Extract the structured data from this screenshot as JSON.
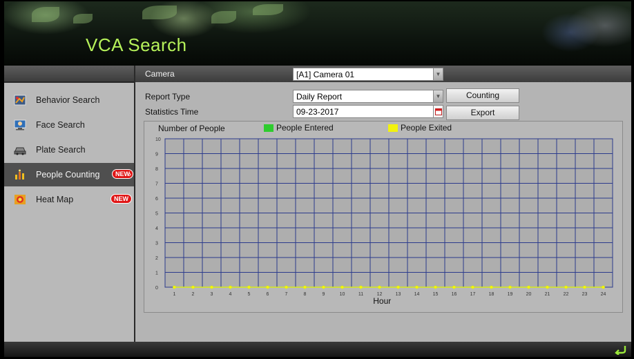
{
  "header": {
    "title": "VCA Search"
  },
  "sidebar": {
    "items": [
      {
        "label": "Behavior Search",
        "icon": "behavior-search-icon"
      },
      {
        "label": "Face Search",
        "icon": "face-search-icon"
      },
      {
        "label": "Plate Search",
        "icon": "plate-search-icon"
      },
      {
        "label": "People Counting",
        "icon": "people-counting-icon",
        "badge": "NEW",
        "active": true
      },
      {
        "label": "Heat Map",
        "icon": "heat-map-icon",
        "badge": "NEW"
      }
    ]
  },
  "form": {
    "camera_label": "Camera",
    "camera_value": "[A1] Camera 01",
    "report_type_label": "Report Type",
    "report_type_value": "Daily Report",
    "statistics_time_label": "Statistics Time",
    "statistics_time_value": "09-23-2017",
    "counting_button": "Counting",
    "export_button": "Export"
  },
  "colors": {
    "entered": "#2ecc2e",
    "exited": "#f2f20e",
    "grid": "#2b3a8c",
    "title_accent": "#b6f25a"
  },
  "chart_data": {
    "type": "line",
    "ylabel": "Number of People",
    "xlabel": "Hour",
    "x": [
      1,
      2,
      3,
      4,
      5,
      6,
      7,
      8,
      9,
      10,
      11,
      12,
      13,
      14,
      15,
      16,
      17,
      18,
      19,
      20,
      21,
      22,
      23,
      24
    ],
    "ylim": [
      0,
      10
    ],
    "yticks": [
      0,
      1,
      2,
      3,
      4,
      5,
      6,
      7,
      8,
      9,
      10
    ],
    "grid": true,
    "legend_position": "top",
    "series": [
      {
        "name": "People Entered",
        "color": "#2ecc2e",
        "values": [
          0,
          0,
          0,
          0,
          0,
          0,
          0,
          0,
          0,
          0,
          0,
          0,
          0,
          0,
          0,
          0,
          0,
          0,
          0,
          0,
          0,
          0,
          0,
          0
        ]
      },
      {
        "name": "People Exited",
        "color": "#f2f20e",
        "values": [
          0,
          0,
          0,
          0,
          0,
          0,
          0,
          0,
          0,
          0,
          0,
          0,
          0,
          0,
          0,
          0,
          0,
          0,
          0,
          0,
          0,
          0,
          0,
          0
        ]
      }
    ]
  }
}
